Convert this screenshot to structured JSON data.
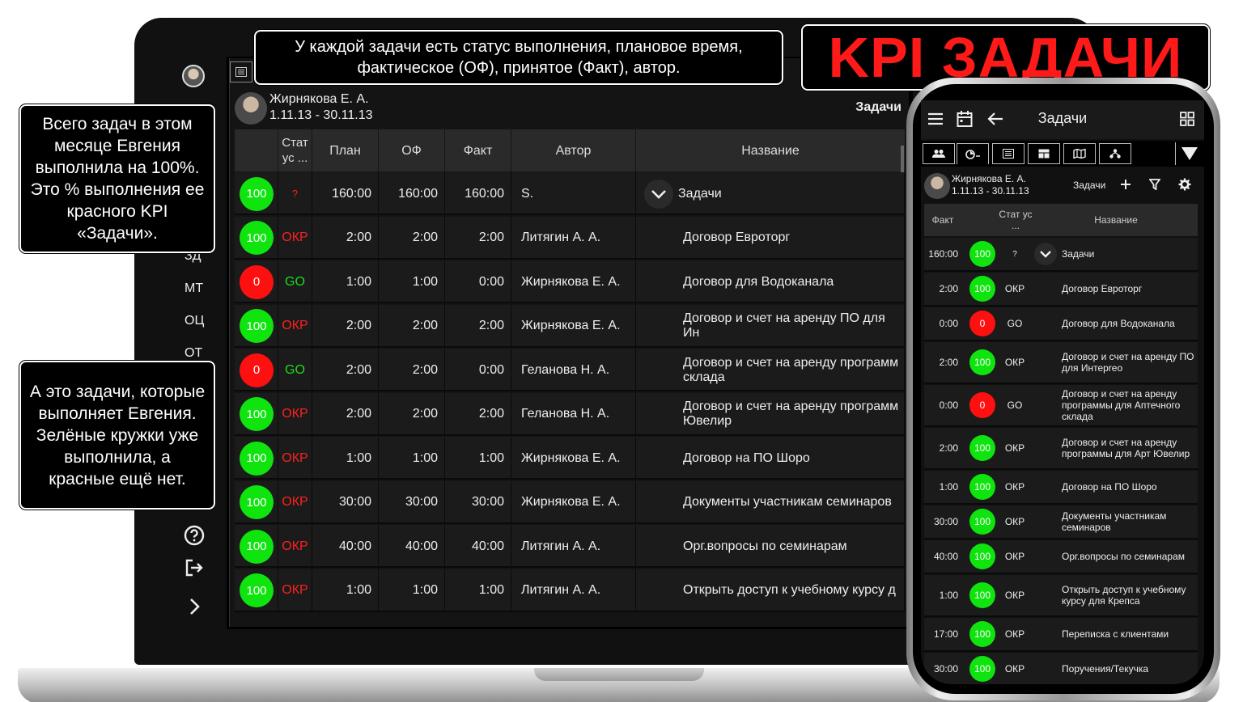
{
  "banner": {
    "title": "KPI ЗАДАЧИ"
  },
  "callouts": {
    "top": "У каждой задачи есть статус выполнения, плановое время, фактическое (ОФ), принятое (Факт), автор.",
    "left_top": "Всего задач в этом месяце Евгения выполнила на 100%. Это % выполнения ее красного KPI «Задачи».",
    "left_bottom": "А это задачи, которые выполняет Евгения. Зелёные кружки уже выполнила, а красные ещё нет."
  },
  "laptop": {
    "sidebar": {
      "items": [
        "ЗД",
        "МТ",
        "ОЦ",
        "ОТ"
      ],
      "icons": [
        "help-icon",
        "logout-icon",
        "chevron-right-icon"
      ]
    },
    "user": {
      "name": "Жирнякова Е. А.",
      "period": "1.11.13 - 30.11.13"
    },
    "section_title": "Задачи",
    "columns": [
      "",
      "Стат ус ...",
      "План",
      "ОФ",
      "Факт",
      "Автор",
      "Название"
    ],
    "rows": [
      {
        "pct": "100",
        "done": true,
        "status": "?",
        "plan": "160:00",
        "of": "160:00",
        "fact": "160:00",
        "author": "S.",
        "name": "Задачи",
        "group": true
      },
      {
        "pct": "100",
        "done": true,
        "status": "ОКР",
        "plan": "2:00",
        "of": "2:00",
        "fact": "2:00",
        "author": "Литягин А. А.",
        "name": "Договор Евроторг"
      },
      {
        "pct": "0",
        "done": false,
        "status": "GO",
        "plan": "1:00",
        "of": "1:00",
        "fact": "0:00",
        "author": "Жирнякова Е. А.",
        "name": "Договор для Водоканала"
      },
      {
        "pct": "100",
        "done": true,
        "status": "ОКР",
        "plan": "2:00",
        "of": "2:00",
        "fact": "2:00",
        "author": "Жирнякова Е. А.",
        "name": "Договор и счет на аренду ПО для Ин"
      },
      {
        "pct": "0",
        "done": false,
        "status": "GO",
        "plan": "2:00",
        "of": "2:00",
        "fact": "0:00",
        "author": "Геланова Н. А.",
        "name": "Договор и счет на аренду программ склада"
      },
      {
        "pct": "100",
        "done": true,
        "status": "ОКР",
        "plan": "2:00",
        "of": "2:00",
        "fact": "2:00",
        "author": "Геланова Н. А.",
        "name": "Договор и счет на аренду программ Ювелир"
      },
      {
        "pct": "100",
        "done": true,
        "status": "ОКР",
        "plan": "1:00",
        "of": "1:00",
        "fact": "1:00",
        "author": "Жирнякова Е. А.",
        "name": "Договор на ПО Шоро"
      },
      {
        "pct": "100",
        "done": true,
        "status": "ОКР",
        "plan": "30:00",
        "of": "30:00",
        "fact": "30:00",
        "author": "Жирнякова Е. А.",
        "name": "Документы участникам семинаров"
      },
      {
        "pct": "100",
        "done": true,
        "status": "ОКР",
        "plan": "40:00",
        "of": "40:00",
        "fact": "40:00",
        "author": "Литягин А. А.",
        "name": "Орг.вопросы по семинарам"
      },
      {
        "pct": "100",
        "done": true,
        "status": "ОКР",
        "plan": "1:00",
        "of": "1:00",
        "fact": "1:00",
        "author": "Литягин А. А.",
        "name": "Открыть доступ к учебному курсу д"
      }
    ]
  },
  "phone": {
    "header_title": "Задачи",
    "user": {
      "name": "Жирнякова Е. А.",
      "period": "1.11.13 - 30.11.13"
    },
    "section_title": "Задачи",
    "columns": [
      "Факт",
      "",
      "Стат ус ...",
      "Название"
    ],
    "rows": [
      {
        "fact": "160:00",
        "pct": "100",
        "done": true,
        "status": "?",
        "name": "Задачи",
        "group": true
      },
      {
        "fact": "2:00",
        "pct": "100",
        "done": true,
        "status": "ОКР",
        "name": "Договор Евроторг"
      },
      {
        "fact": "0:00",
        "pct": "0",
        "done": false,
        "status": "GO",
        "name": "Договор для Водоканала"
      },
      {
        "fact": "2:00",
        "pct": "100",
        "done": true,
        "status": "ОКР",
        "name": "Договор и счет на аренду ПО для Интерreo"
      },
      {
        "fact": "0:00",
        "pct": "0",
        "done": false,
        "status": "GO",
        "name": "Договор и счет на аренду программы для Аптечного склада"
      },
      {
        "fact": "2:00",
        "pct": "100",
        "done": true,
        "status": "ОКР",
        "name": "Договор и счет на аренду программы для Арт Ювелир"
      },
      {
        "fact": "1:00",
        "pct": "100",
        "done": true,
        "status": "ОКР",
        "name": "Договор на ПО Шоро"
      },
      {
        "fact": "30:00",
        "pct": "100",
        "done": true,
        "status": "ОКР",
        "name": "Документы участникам семинаров"
      },
      {
        "fact": "40:00",
        "pct": "100",
        "done": true,
        "status": "ОКР",
        "name": "Орг.вопросы по семинарам"
      },
      {
        "fact": "1:00",
        "pct": "100",
        "done": true,
        "status": "ОКР",
        "name": "Открыть доступ к учебному курсу для Крепса"
      },
      {
        "fact": "17:00",
        "pct": "100",
        "done": true,
        "status": "ОКР",
        "name": "Переписка с клиентами"
      },
      {
        "fact": "30:00",
        "pct": "100",
        "done": true,
        "status": "ОКР",
        "name": "Поручения/Текучка"
      }
    ]
  },
  "colors": {
    "done": "#0fe40f",
    "not_done": "#ff1010",
    "okr": "#ff2020",
    "go": "#1adc1a",
    "kpi_title": "#ff1a1a"
  }
}
